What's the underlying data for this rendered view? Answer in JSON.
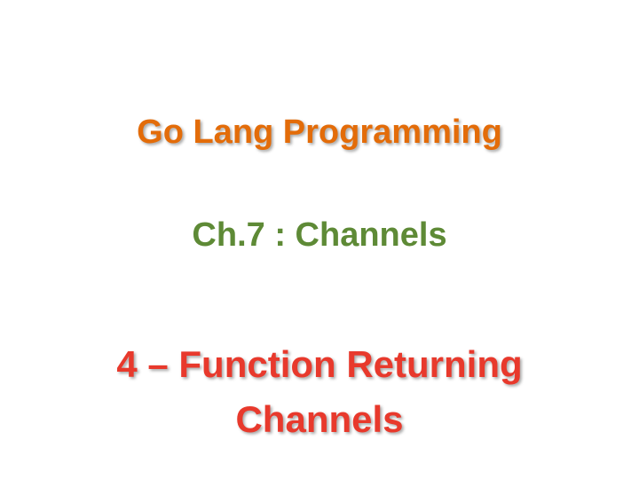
{
  "slide": {
    "title": "Go Lang Programming",
    "chapter": "Ch.7 : Channels",
    "topic_line1": "4 – Function Returning",
    "topic_line2": "Channels"
  },
  "colors": {
    "title": "#e36c09",
    "chapter": "#5e8a36",
    "topic": "#e8392c",
    "background": "#ffffff"
  }
}
